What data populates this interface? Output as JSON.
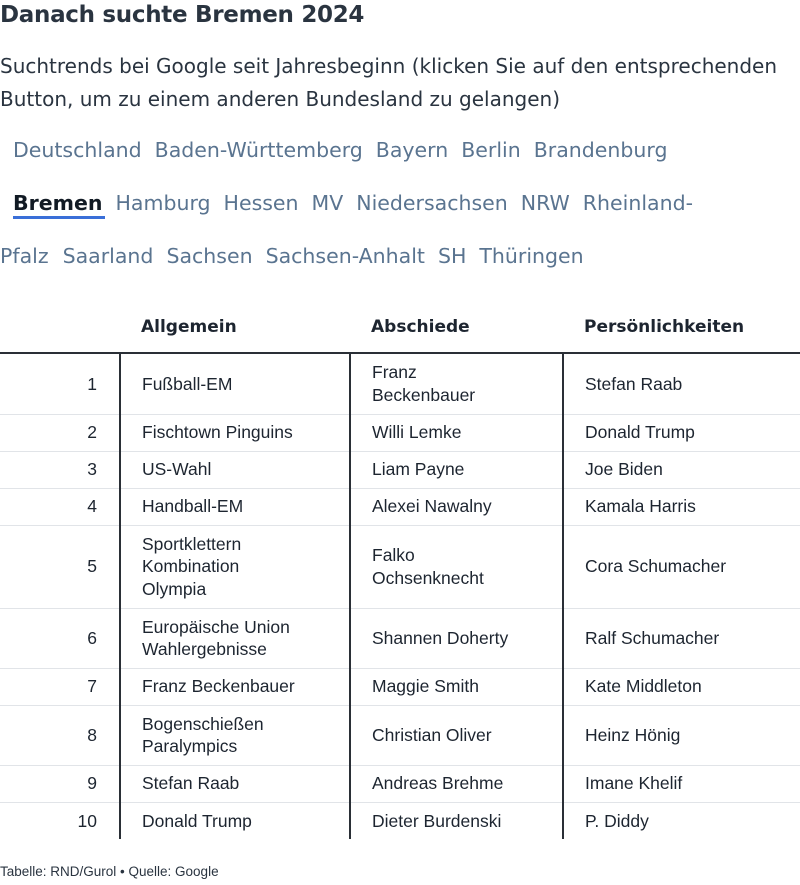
{
  "title": "Danach suchte Bremen 2024",
  "subtitle": "Suchtrends bei Google seit Jahresbeginn (klicken Sie auf den entsprechenden Button, um zu einem anderen Bundesland zu gelangen)",
  "tabs": {
    "row1": [
      "Deutschland",
      "Baden-Württemberg",
      "Bayern",
      "Berlin",
      "Brandenburg"
    ],
    "active": "Bremen",
    "row2": [
      "Hamburg",
      "Hessen",
      "MV",
      "Niedersachsen",
      "NRW"
    ],
    "rheinland_part1": "Rheinland-",
    "rheinland_part2": "Pfalz",
    "row3": [
      "Saarland",
      "Sachsen",
      "Sachsen-Anhalt",
      "SH",
      "Thüringen"
    ]
  },
  "table": {
    "headers": [
      "",
      "Allgemein",
      "Abschiede",
      "Persönlichkeiten"
    ],
    "rows": [
      {
        "rank": "1",
        "allgemein": [
          "Fußball-EM"
        ],
        "abschiede": [
          "Franz",
          "Beckenbauer"
        ],
        "personen": [
          "Stefan Raab"
        ]
      },
      {
        "rank": "2",
        "allgemein": [
          "Fischtown Pinguins"
        ],
        "abschiede": [
          "Willi Lemke"
        ],
        "personen": [
          "Donald Trump"
        ]
      },
      {
        "rank": "3",
        "allgemein": [
          "US-Wahl"
        ],
        "abschiede": [
          "Liam Payne"
        ],
        "personen": [
          "Joe Biden"
        ]
      },
      {
        "rank": "4",
        "allgemein": [
          "Handball-EM"
        ],
        "abschiede": [
          "Alexei Nawalny"
        ],
        "personen": [
          "Kamala Harris"
        ]
      },
      {
        "rank": "5",
        "allgemein": [
          "Sportklettern",
          "Kombination",
          "Olympia"
        ],
        "abschiede": [
          "Falko",
          "Ochsenknecht"
        ],
        "personen": [
          "Cora Schumacher"
        ]
      },
      {
        "rank": "6",
        "allgemein": [
          "Europäische Union",
          "Wahlergebnisse"
        ],
        "abschiede": [
          "Shannen Doherty"
        ],
        "personen": [
          "Ralf Schumacher"
        ]
      },
      {
        "rank": "7",
        "allgemein": [
          "Franz Beckenbauer"
        ],
        "abschiede": [
          "Maggie Smith"
        ],
        "personen": [
          "Kate Middleton"
        ]
      },
      {
        "rank": "8",
        "allgemein": [
          "Bogenschießen",
          "Paralympics"
        ],
        "abschiede": [
          "Christian Oliver"
        ],
        "personen": [
          "Heinz Hönig"
        ]
      },
      {
        "rank": "9",
        "allgemein": [
          "Stefan Raab"
        ],
        "abschiede": [
          "Andreas Brehme"
        ],
        "personen": [
          "Imane Khelif"
        ]
      },
      {
        "rank": "10",
        "allgemein": [
          "Donald Trump"
        ],
        "abschiede": [
          "Dieter Burdenski"
        ],
        "personen": [
          "P. Diddy"
        ]
      }
    ]
  },
  "footer": "Tabelle: RND/Gurol • Quelle: Google",
  "colors": {
    "accent": "#3a6fd8",
    "tab_link": "#5a7490",
    "text": "#1d2530"
  }
}
